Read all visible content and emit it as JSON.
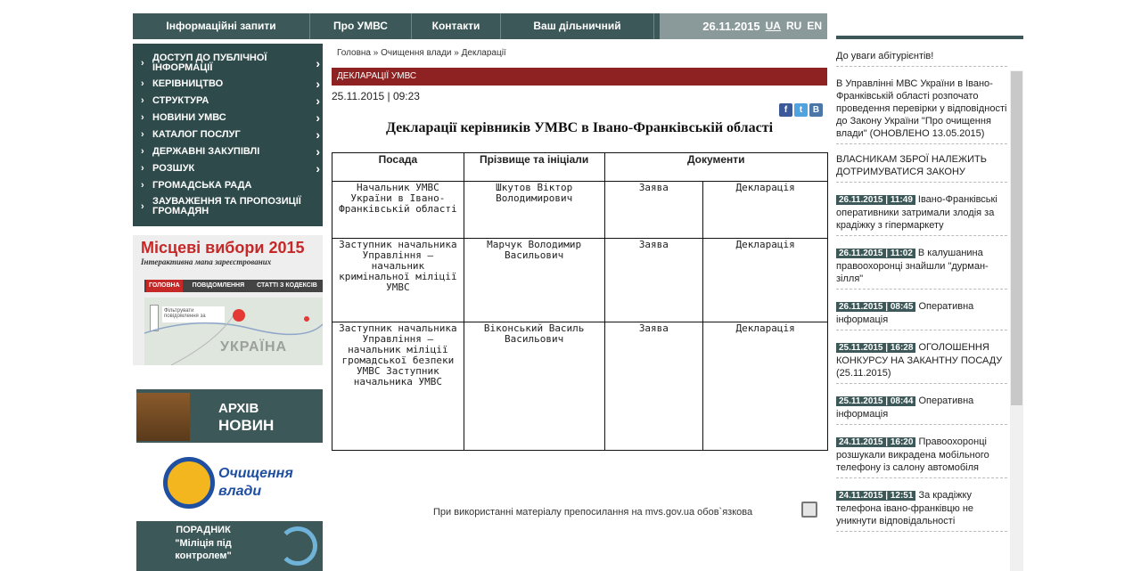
{
  "topnav": {
    "items": [
      {
        "label": "Інформаційні запити"
      },
      {
        "label": "Про УМВС"
      },
      {
        "label": "Контакти"
      },
      {
        "label": "Ваш дільничний"
      }
    ],
    "date": "26.11.2015",
    "langs": [
      "UA",
      "RU",
      "EN"
    ]
  },
  "leftmenu": {
    "items": [
      {
        "label": "Доступ до публічної інформації"
      },
      {
        "label": "Керівництво"
      },
      {
        "label": "Структура"
      },
      {
        "label": "Новини УМВС"
      },
      {
        "label": "Каталог послуг"
      },
      {
        "label": "Державні закупівлі"
      },
      {
        "label": "Розшук"
      },
      {
        "label": "Громадська рада"
      },
      {
        "label": "Зауваження та пропозиції громадян"
      }
    ]
  },
  "elections": {
    "title": "Місцеві вибори 2015",
    "subtitle": "Інтерактивна мапа зареєстрованих",
    "tabs": [
      "ГОЛОВНА",
      "ПОВІДОМЛЕННЯ",
      "СТАТТІ З КОДЕКСІВ"
    ],
    "filter": "Фільтрувати повідомлення за",
    "map_label": "УКРАЇНА"
  },
  "archive": {
    "line1": "АРХІВ",
    "line2": "НОВИН"
  },
  "cleanup": {
    "line1": "Очищення",
    "line2": "влади"
  },
  "guide": {
    "line1": "ПОРАДНИК",
    "line2": "\"Міліція під",
    "line3": "контролем\""
  },
  "breadcrumb": {
    "home": "Головна",
    "sep": " » ",
    "section": "Очищення влади",
    "current": "Декларації"
  },
  "section_bar": "ДЕКЛАРАЦІЇ УМВС",
  "pubdate": "25.11.2015 | 09:23",
  "share": [
    {
      "icon": "facebook-icon",
      "glyph": "f",
      "color": "#3b5998"
    },
    {
      "icon": "twitter-icon",
      "glyph": "t",
      "color": "#4fa3e0"
    },
    {
      "icon": "vkontakte-icon",
      "glyph": "B",
      "color": "#4a76a8"
    }
  ],
  "title": "Декларації керівників УМВС в Івано-Франківській області",
  "table": {
    "headers": {
      "position": "Посада",
      "name": "Прізвище та ініціали",
      "documents": "Документи"
    },
    "rows": [
      {
        "position": "Начальник УМВС України в Івано-Франківській області",
        "name": "Шкутов Віктор Володимирович",
        "doc1": "Заява",
        "doc2": "Декларація"
      },
      {
        "position": "Заступник начальника Управління – начальник кримінальної міліції УМВС",
        "name": "Марчук Володимир Васильович",
        "doc1": "Заява",
        "doc2": "Декларація"
      },
      {
        "position": "Заступник начальника Управління – начальник міліції громадської безпеки УМВС Заступник начальника УМВС",
        "name": "Віконський Василь Васильович",
        "doc1": "Заява",
        "doc2": "Декларація"
      }
    ]
  },
  "footnote": "При використанні матеріалу препосилання на mvs.gov.ua обов`язкова",
  "rightcol": {
    "news": [
      {
        "date": "",
        "text": "До уваги абітурієнтів!"
      },
      {
        "date": "",
        "text": "В Управлінні МВС України в Івано-Франківській області розпочато проведення перевірки у відповідності до Закону України \"Про очищення влади\" (ОНОВЛЕНО 13.05.2015)"
      },
      {
        "date": "",
        "text": "ВЛАСНИКАМ ЗБРОЇ НАЛЕЖИТЬ ДОТРИМУВАТИСЯ ЗАКОНУ"
      },
      {
        "date": "26.11.2015 | 11:49",
        "text": "Івано-Франківські оперативники затримали злодія за крадіжку з гіпермаркету"
      },
      {
        "date": "26.11.2015 | 11:02",
        "text": "В калушанина правоохоронці знайшли \"дурман-зілля\""
      },
      {
        "date": "26.11.2015 | 08:45",
        "text": "Оперативна інформація"
      },
      {
        "date": "25.11.2015 | 16:28",
        "text": "ОГОЛОШЕННЯ КОНКУРСУ НА ЗАКАНТНУ ПОСАДУ (25.11.2015)"
      },
      {
        "date": "25.11.2015 | 08:44",
        "text": "Оперативна інформація"
      },
      {
        "date": "24.11.2015 | 16:20",
        "text": "Правоохоронці розшукали викрадена мобільного телефону із салону автомобіля"
      },
      {
        "date": "24.11.2015 | 12:51",
        "text": "За крадіжку телефона івано-франківцю не уникнути відповідальності"
      }
    ]
  }
}
